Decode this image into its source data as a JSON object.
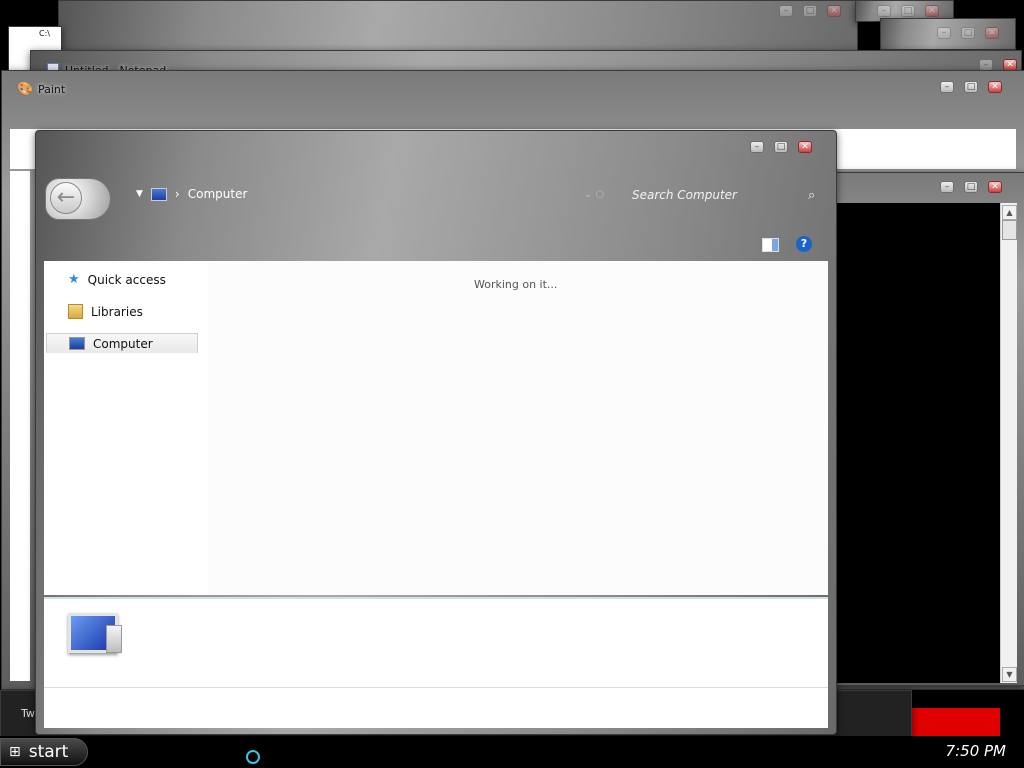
{
  "background_windows": {
    "notepad_title": "Untitled - Notepad",
    "paint_title": "Paint",
    "cmd_label": "C:\\",
    "bottom_left_label": "Tw"
  },
  "explorer": {
    "breadcrumb": {
      "location": "Computer",
      "separator": "›"
    },
    "search_placeholder": "Search Computer",
    "status_text": "Working on it...",
    "nav": {
      "items": [
        {
          "label": "Quick access",
          "icon": "star-icon"
        },
        {
          "label": "Libraries",
          "icon": "libraries-icon"
        },
        {
          "label": "Computer",
          "icon": "computer-icon",
          "selected": true
        }
      ]
    },
    "toolbar": {
      "help_label": "?"
    }
  },
  "taskbar": {
    "start_label": "start",
    "clock": "7:50 PM"
  },
  "colors": {
    "close_red": "#c94141",
    "help_blue": "#1a63c8",
    "terminal_bg": "#000000",
    "accent_red": "#e10000"
  }
}
